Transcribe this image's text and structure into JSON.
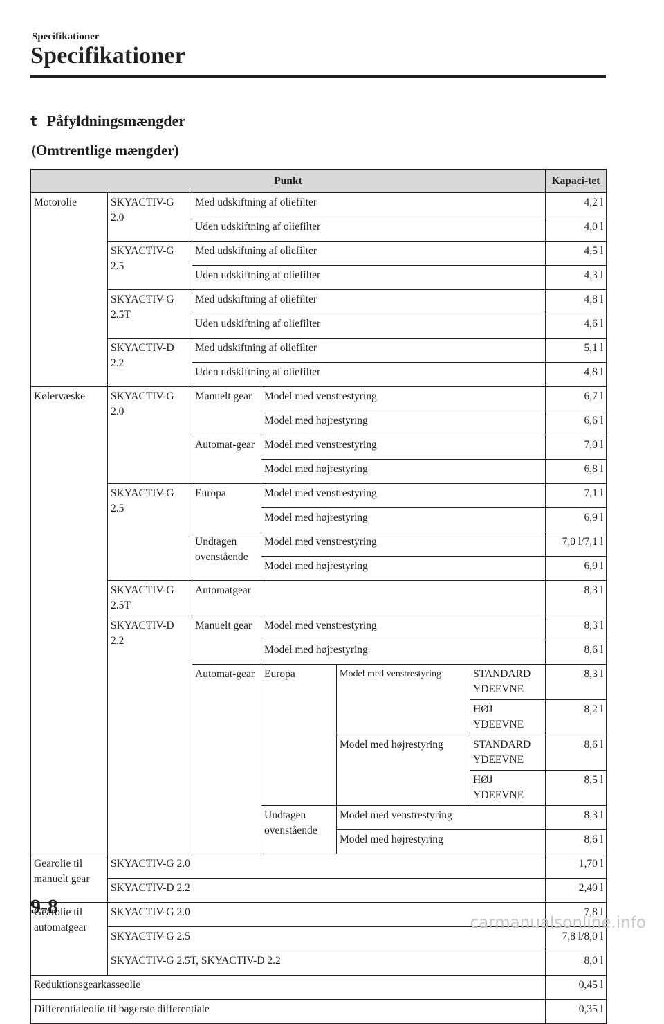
{
  "header": {
    "small": "Specifikationer",
    "title": "Specifikationer"
  },
  "section": {
    "marker": "t",
    "title": "Påfyldningsmængder",
    "subtitle": "(Omtrentlige mængder)"
  },
  "table": {
    "col_item": "Punkt",
    "col_capacity": "Kapaci-tet",
    "motorolie": {
      "label": "Motorolie",
      "with_filter": "Med udskiftning af oliefilter",
      "without_filter": "Uden udskiftning af oliefilter",
      "engines": [
        {
          "name": "SKYACTIV-G 2.0",
          "with": "4,2 l",
          "without": "4,0 l"
        },
        {
          "name": "SKYACTIV-G 2.5",
          "with": "4,5 l",
          "without": "4,3 l"
        },
        {
          "name": "SKYACTIV-G 2.5T",
          "with": "4,8 l",
          "without": "4,6 l"
        },
        {
          "name": "SKYACTIV-D 2.2",
          "with": "5,1 l",
          "without": "4,8 l"
        }
      ]
    },
    "kolervaeske": {
      "label": "Kølervæske",
      "left": "Model med venstrestyring",
      "right": "Model med højrestyring",
      "g20": {
        "name": "SKYACTIV-G 2.0",
        "manual": "Manuelt gear",
        "auto": "Automat-gear",
        "manual_left": "6,7 l",
        "manual_right": "6,6 l",
        "auto_left": "7,0 l",
        "auto_right": "6,8 l"
      },
      "g25": {
        "name": "SKYACTIV-G 2.5",
        "europe": "Europa",
        "other": "Undtagen ovenstående",
        "europe_left": "7,1 l",
        "europe_right": "6,9 l",
        "other_left": "7,0 l/7,1 l",
        "other_right": "6,9 l"
      },
      "g25t": {
        "name": "SKYACTIV-G 2.5T",
        "gear": "Automatgear",
        "value": "8,3 l"
      },
      "d22": {
        "name": "SKYACTIV-D 2.2",
        "manual": "Manuelt gear",
        "auto": "Automat-gear",
        "europe": "Europa",
        "other": "Undtagen ovenstående",
        "left_small": "Model med venstrestyring",
        "right_small": "Model med højrestyring",
        "standard": "STANDARD YDEEVNE",
        "high": "HØJ YDEEVNE",
        "manual_left": "8,3 l",
        "manual_right": "8,6 l",
        "eu_left_standard": "8,3 l",
        "eu_left_high": "8,2 l",
        "eu_right_standard": "8,6 l",
        "eu_right_high": "8,5 l",
        "other_left": "8,3 l",
        "other_right": "8,6 l"
      }
    },
    "gear_manual": {
      "label": "Gearolie til manuelt gear",
      "rows": [
        {
          "engine": "SKYACTIV-G 2.0",
          "value": "1,70 l"
        },
        {
          "engine": "SKYACTIV-D 2.2",
          "value": "2,40 l"
        }
      ]
    },
    "gear_auto": {
      "label": "Gearolie til automatgear",
      "rows": [
        {
          "engine": "SKYACTIV-G 2.0",
          "value": "7,8 l"
        },
        {
          "engine": "SKYACTIV-G 2.5",
          "value": "7,8 l/8,0 l"
        },
        {
          "engine": "SKYACTIV-G 2.5T, SKYACTIV-D 2.2",
          "value": "8,0 l"
        }
      ]
    },
    "reduction": {
      "label": "Reduktionsgearkasseolie",
      "value": "0,45 l"
    },
    "differential": {
      "label": "Differentialeolie til bagerste differentiale",
      "value": "0,35 l"
    }
  },
  "footer": {
    "page_number": "9-8",
    "watermark": "carmanualsonline.info"
  }
}
